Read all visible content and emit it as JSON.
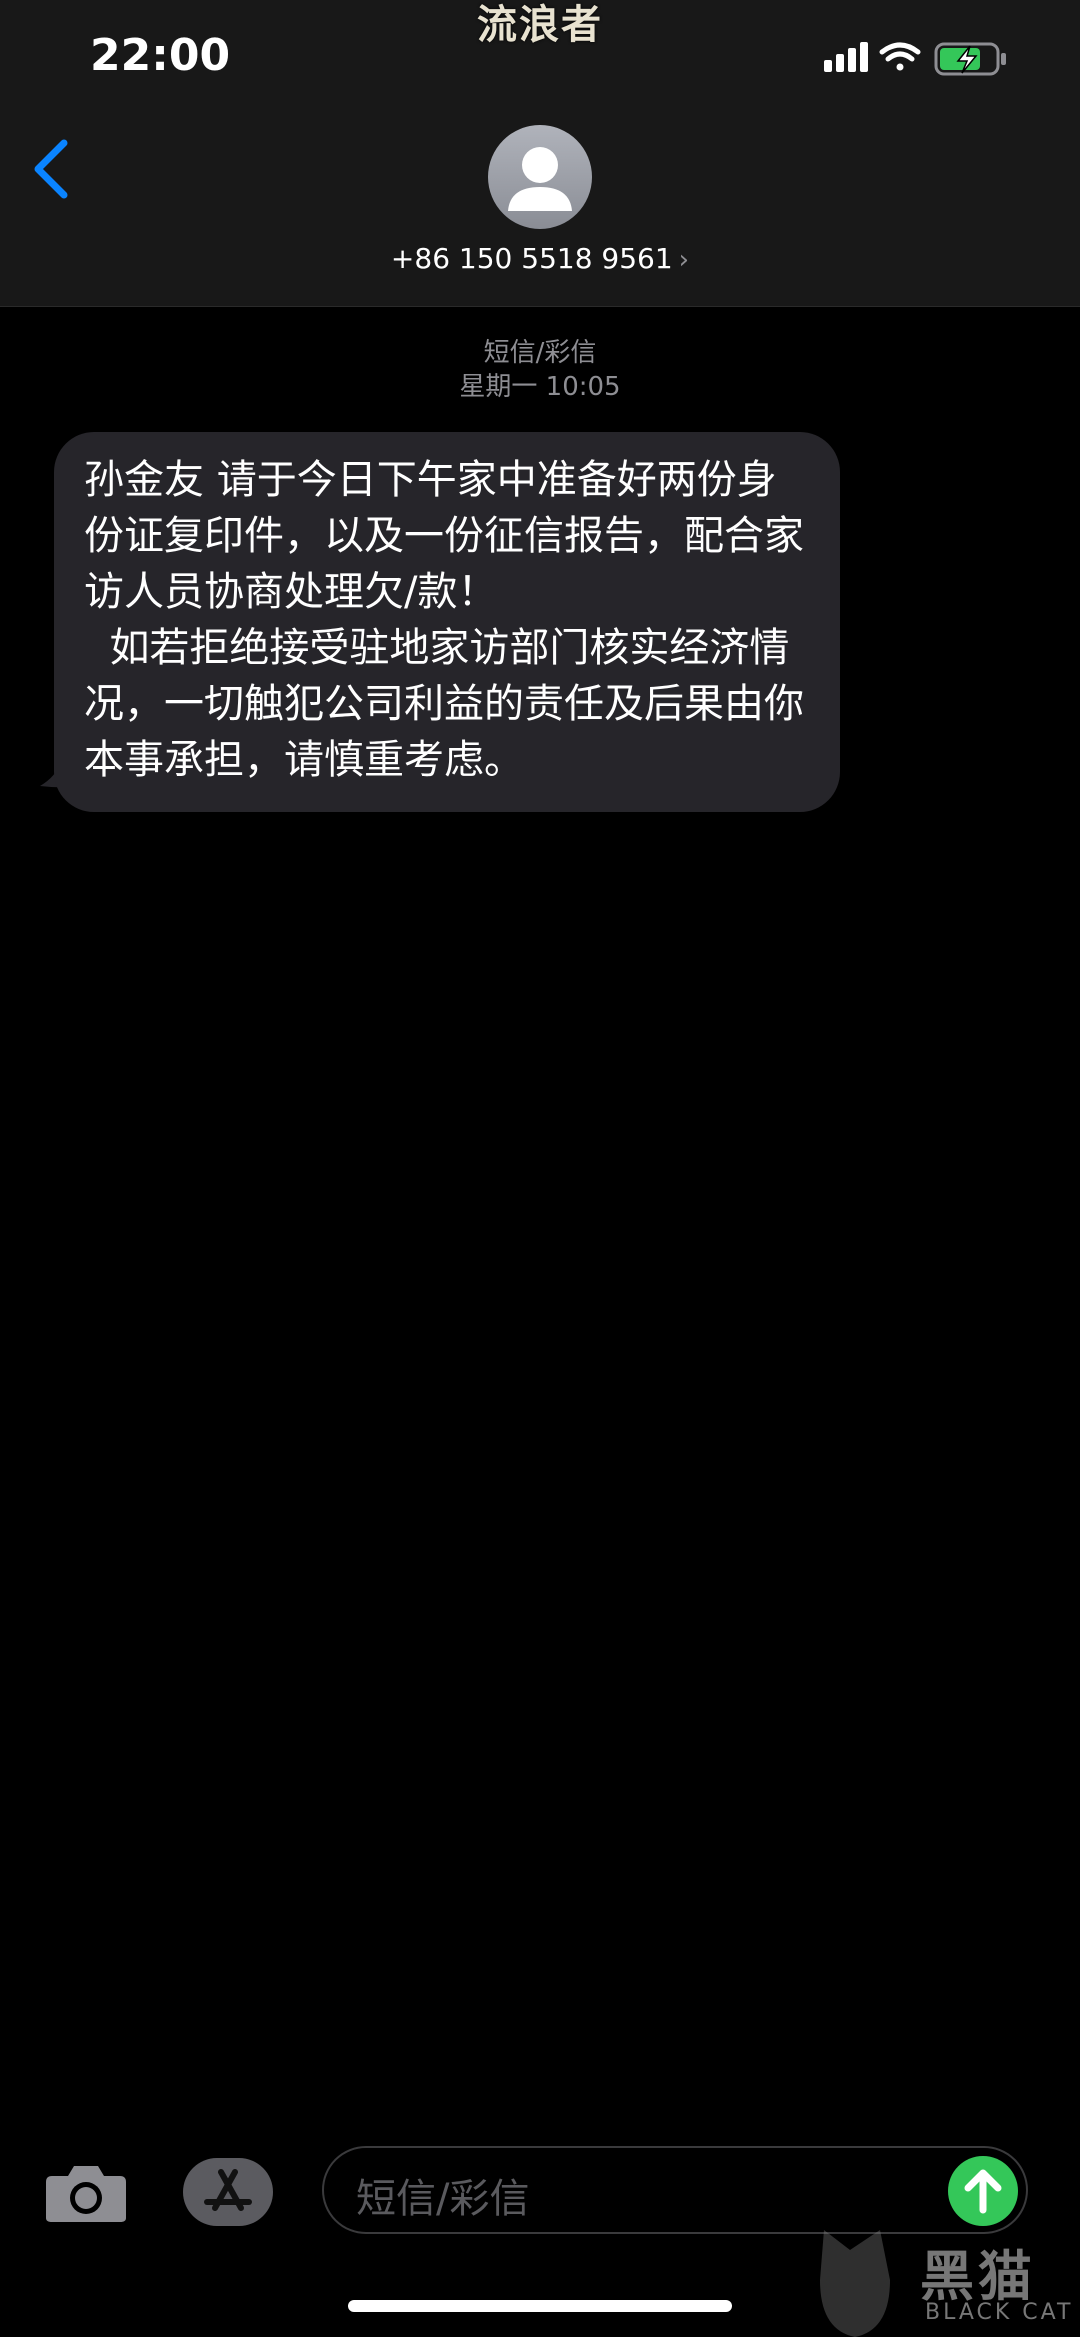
{
  "overlay": {
    "top_watermark": "流浪者"
  },
  "status": {
    "time": "22:00"
  },
  "header": {
    "contact": "+86 150 5518 9561",
    "chevron": "›"
  },
  "thread": {
    "service": "短信/彩信",
    "timestamp": "星期一 10:05",
    "messages": [
      {
        "from": "them",
        "text": "孙金友 请于今日下午家中准备好两份身份证复印件，以及一份征信报告，配合家访人员协商处理欠/款！\n  如若拒绝接受驻地家访部门核实经济情况，一切触犯公司利益的责任及后果由你本事承担，请慎重考虑。"
      }
    ]
  },
  "composer": {
    "placeholder": "短信/彩信"
  },
  "brand_watermark": {
    "text": "黑猫",
    "sub": "BLACK CAT"
  },
  "colors": {
    "accent": "#0a84ff",
    "send": "#34c759",
    "bubble": "#26252a",
    "bar": "#181818"
  },
  "icons": [
    "signal-icon",
    "wifi-icon",
    "battery-charging-icon",
    "back-chevron-icon",
    "person-icon",
    "camera-icon",
    "app-store-icon",
    "send-arrow-icon"
  ]
}
